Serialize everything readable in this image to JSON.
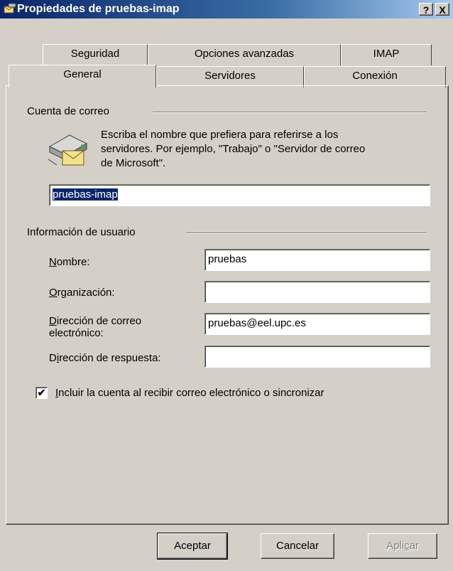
{
  "window": {
    "title": "Propiedades de pruebas-imap",
    "help_label": "?",
    "close_label": "X"
  },
  "tabs": {
    "row1": [
      "Seguridad",
      "Opciones avanzadas",
      "IMAP"
    ],
    "row2": [
      "General",
      "Servidores",
      "Conexión"
    ],
    "selected": "General"
  },
  "account_group": {
    "label": "Cuenta de correo",
    "description": "Escriba el nombre que prefiera para referirse a los servidores. Por ejemplo, \"Trabajo\" o \"Servidor de correo de Microsoft\".",
    "description_lines": [
      "Escriba el nombre que prefiera para referirse a los",
      "servidores. Por ejemplo, \"Trabajo\" o \"Servidor de correo",
      "de Microsoft\"."
    ],
    "account_name_value": "pruebas-imap",
    "icon": "mail-server-icon"
  },
  "user_group": {
    "label": "Información de usuario",
    "name_label": {
      "key": "N",
      "rest": "ombre:"
    },
    "name_value": "pruebas",
    "org_label": {
      "key": "O",
      "rest": "rganización:"
    },
    "org_value": "",
    "email_label_line1": {
      "key": "D",
      "rest": "irección de correo"
    },
    "email_label_line2": "electrónico:",
    "email_value": "pruebas@eel.upc.es",
    "reply_label": {
      "pre": "D",
      "key": "i",
      "rest": "rección de respuesta:"
    },
    "reply_value": ""
  },
  "include_checkbox": {
    "key": "I",
    "rest": "ncluir la cuenta al recibir correo electrónico o sincronizar",
    "checked": true
  },
  "buttons": {
    "ok": "Aceptar",
    "cancel": "Cancelar",
    "apply": {
      "pre": "Apli",
      "key": "c",
      "rest": "ar"
    }
  },
  "colors": {
    "face": "#d4d0c8",
    "title_start": "#0a246a",
    "title_end": "#a6caf0",
    "selection": "#0a246a"
  }
}
